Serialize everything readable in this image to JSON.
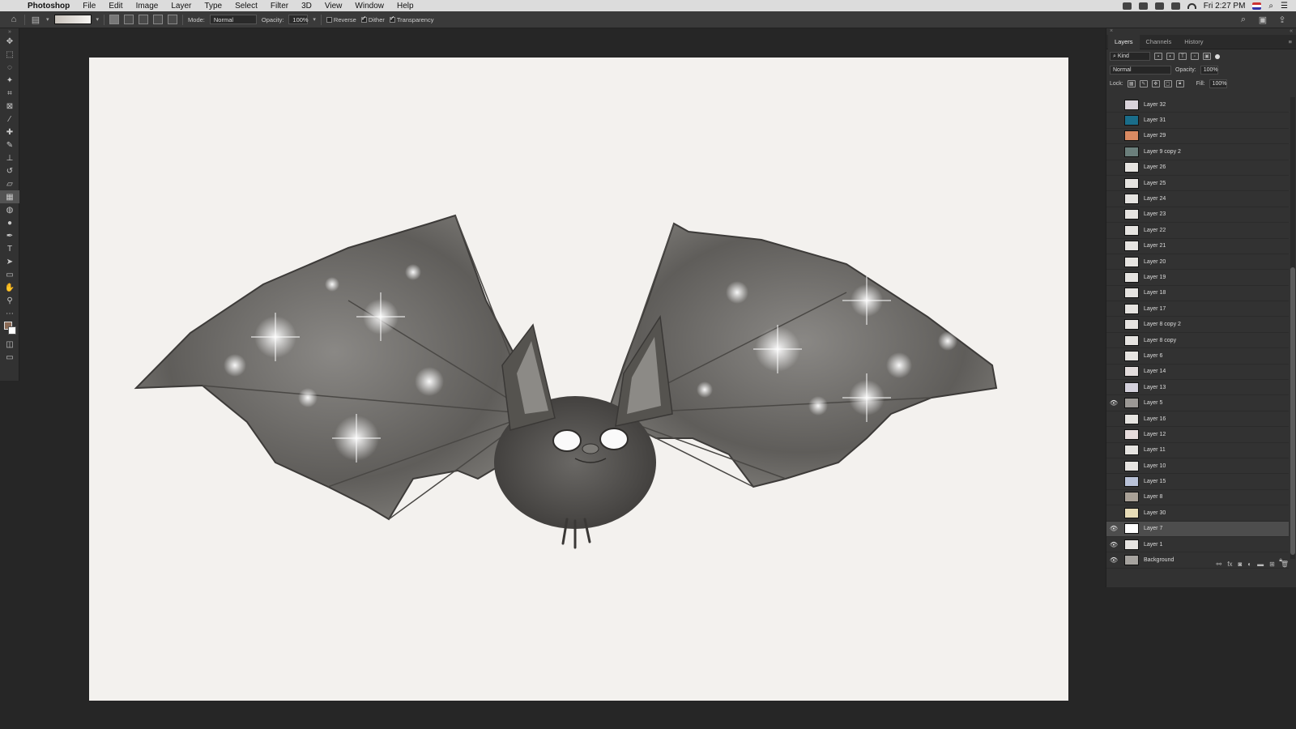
{
  "menubar": {
    "app_name": "Photoshop",
    "items": [
      "File",
      "Edit",
      "Image",
      "Layer",
      "Type",
      "Select",
      "Filter",
      "3D",
      "View",
      "Window",
      "Help"
    ],
    "clock": "Fri 2:27 PM"
  },
  "options": {
    "mode_label": "Mode:",
    "mode_value": "Normal",
    "opacity_label": "Opacity:",
    "opacity_value": "100%",
    "reverse_label": "Reverse",
    "dither_label": "Dither",
    "transparency_label": "Transparency",
    "reverse_checked": false,
    "dither_checked": true,
    "transparency_checked": true
  },
  "panel": {
    "tabs": [
      "Layers",
      "Channels",
      "History"
    ],
    "filter_kind": "Kind",
    "blend_mode": "Normal",
    "opacity_label": "Opacity:",
    "opacity_value": "100%",
    "lock_label": "Lock:",
    "fill_label": "Fill:",
    "fill_value": "100%"
  },
  "layers": [
    {
      "name": "Layer 32",
      "visible": false,
      "thumb": "#d9d3da"
    },
    {
      "name": "Layer 31",
      "visible": false,
      "thumb": "#1a6d8a"
    },
    {
      "name": "Layer 29",
      "visible": false,
      "thumb": "#d98a62"
    },
    {
      "name": "Layer 9 copy 2",
      "visible": false,
      "thumb": "#6b7f7c"
    },
    {
      "name": "Layer 26",
      "visible": false,
      "thumb": "#e6e4e1"
    },
    {
      "name": "Layer 25",
      "visible": false,
      "thumb": "#e6e4e1"
    },
    {
      "name": "Layer 24",
      "visible": false,
      "thumb": "#e6e4e1"
    },
    {
      "name": "Layer 23",
      "visible": false,
      "thumb": "#e6e4e1"
    },
    {
      "name": "Layer 22",
      "visible": false,
      "thumb": "#e6e4e1"
    },
    {
      "name": "Layer 21",
      "visible": false,
      "thumb": "#e6e4e1"
    },
    {
      "name": "Layer 20",
      "visible": false,
      "thumb": "#e6e4e1"
    },
    {
      "name": "Layer 19",
      "visible": false,
      "thumb": "#e6e4e1"
    },
    {
      "name": "Layer 18",
      "visible": false,
      "thumb": "#e6e4e1"
    },
    {
      "name": "Layer 17",
      "visible": false,
      "thumb": "#e6e4e1"
    },
    {
      "name": "Layer 8 copy 2",
      "visible": false,
      "thumb": "#e6e4e1"
    },
    {
      "name": "Layer 8 copy",
      "visible": false,
      "thumb": "#e6e4e1"
    },
    {
      "name": "Layer 6",
      "visible": false,
      "thumb": "#e6e4e1"
    },
    {
      "name": "Layer 14",
      "visible": false,
      "thumb": "#e2dcdc"
    },
    {
      "name": "Layer 13",
      "visible": false,
      "thumb": "#d4d1dc"
    },
    {
      "name": "Layer 5",
      "visible": true,
      "thumb": "#9b9895"
    },
    {
      "name": "Layer 16",
      "visible": false,
      "thumb": "#e6e4e1"
    },
    {
      "name": "Layer 12",
      "visible": false,
      "thumb": "#e6dcdc"
    },
    {
      "name": "Layer 11",
      "visible": false,
      "thumb": "#e6e4e1"
    },
    {
      "name": "Layer 10",
      "visible": false,
      "thumb": "#e6e4e1"
    },
    {
      "name": "Layer 15",
      "visible": false,
      "thumb": "#b9c2d8"
    },
    {
      "name": "Layer 8",
      "visible": false,
      "thumb": "#a8a096"
    },
    {
      "name": "Layer 30",
      "visible": false,
      "thumb": "#e7dcb8"
    },
    {
      "name": "Layer 7",
      "visible": true,
      "thumb": "#ffffff",
      "selected": true
    },
    {
      "name": "Layer 1",
      "visible": true,
      "thumb": "#e6e4e1"
    },
    {
      "name": "Background",
      "visible": true,
      "thumb": "#a6a39f",
      "locked": true
    }
  ],
  "colors": {
    "foreground": "#8a6a55",
    "background": "#ffffff",
    "canvas_paper": "#f3f1ee"
  }
}
